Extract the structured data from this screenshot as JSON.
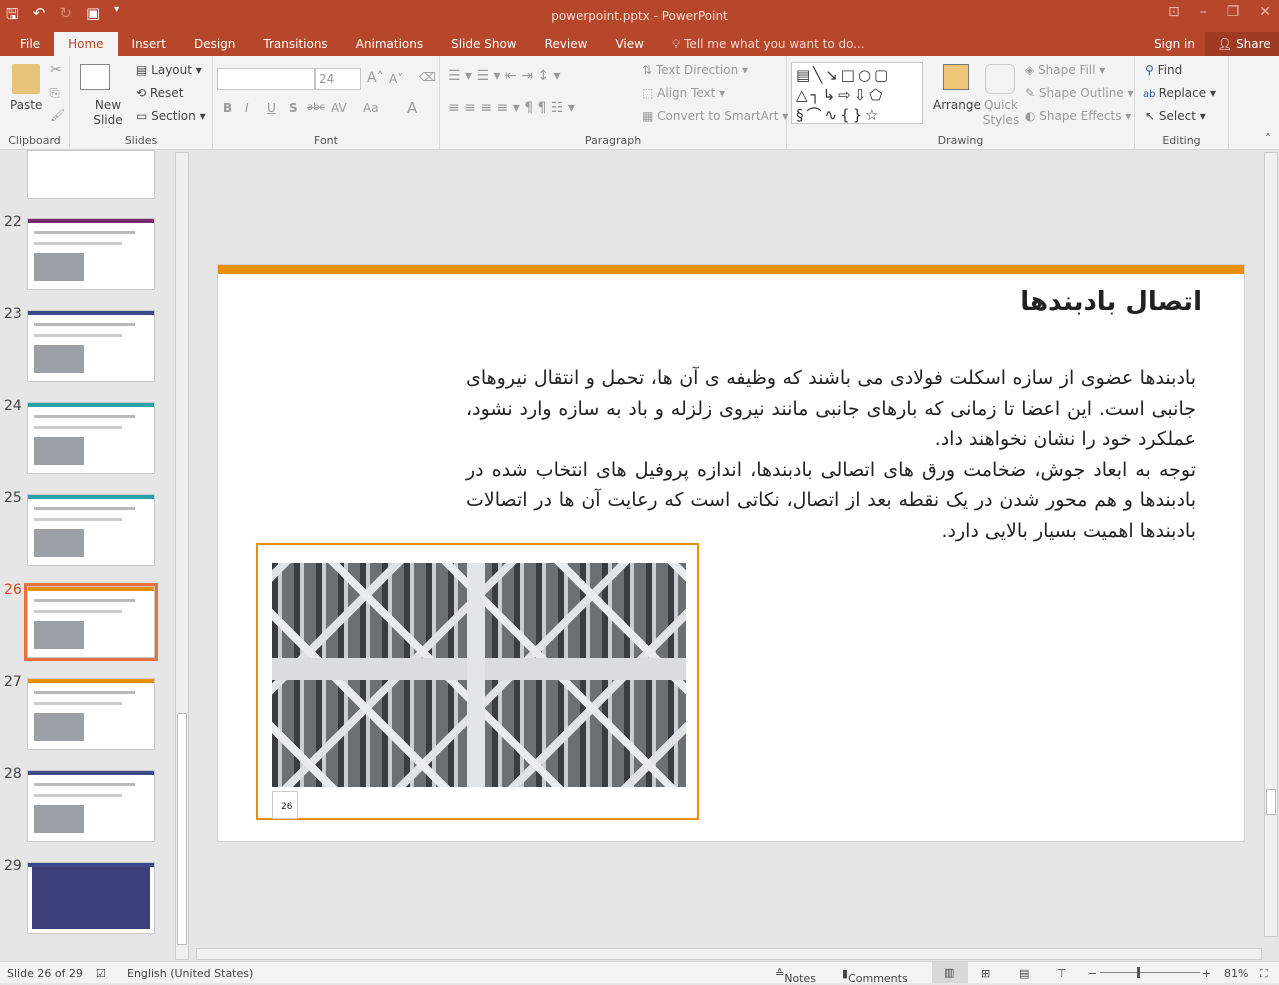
{
  "window": {
    "title": "powerpoint.pptx - PowerPoint"
  },
  "tabs": [
    "File",
    "Home",
    "Insert",
    "Design",
    "Transitions",
    "Animations",
    "Slide Show",
    "Review",
    "View"
  ],
  "tell_me": "Tell me what you want to do...",
  "sign_in": "Sign in",
  "share": "Share",
  "ribbon": {
    "clipboard": {
      "label": "Clipboard",
      "paste": "Paste"
    },
    "slides": {
      "label": "Slides",
      "new_slide": "New Slide",
      "layout": "Layout",
      "reset": "Reset",
      "section": "Section"
    },
    "font": {
      "label": "Font",
      "font_name": "",
      "font_size": "24",
      "bold": "B",
      "italic": "I",
      "underline": "U",
      "shadow": "S",
      "strike": "abc",
      "spacing": "AV",
      "case": "Aa",
      "color": "A"
    },
    "paragraph": {
      "label": "Paragraph",
      "text_direction": "Text Direction",
      "align_text": "Align Text",
      "smartart": "Convert to SmartArt"
    },
    "drawing": {
      "label": "Drawing",
      "arrange": "Arrange",
      "quick_styles": "Quick Styles",
      "shape_fill": "Shape Fill",
      "shape_outline": "Shape Outline",
      "shape_effects": "Shape Effects"
    },
    "editing": {
      "label": "Editing",
      "find": "Find",
      "replace": "Replace",
      "select": "Select"
    }
  },
  "thumbnails": [
    {
      "num": "22"
    },
    {
      "num": "23"
    },
    {
      "num": "24"
    },
    {
      "num": "25"
    },
    {
      "num": "26",
      "selected": true
    },
    {
      "num": "27"
    },
    {
      "num": "28"
    },
    {
      "num": "29"
    }
  ],
  "slide": {
    "title": "اتصال بادبندها",
    "paragraphs": [
      "بادبندها عضوی از سازه اسکلت فولادی می باشند که وظیفه ی آن ها، تحمل و انتقال نیروهای جانبی است. این اعضا تا زمانی که بارهای جانبی مانند نیروی زلزله و باد به سازه وارد نشود، عملکرد خود را نشان نخواهند داد.",
      "توجه به ابعاد جوش، ضخامت ورق های اتصالی بادبندها، اندازه پروفیل های انتخاب شده در بادبندها و هم محور شدن در یک نقطه بعد از اتصال، نکاتی است که رعایت آن ها در اتصالات بادبندها اهمیت بسیار بالایی دارد."
    ],
    "page_number": "26",
    "accent": "#e8900c"
  },
  "status": {
    "slide_info": "Slide 26 of 29",
    "language": "English (United States)",
    "notes": "Notes",
    "comments": "Comments",
    "zoom": "81%"
  },
  "colors": {
    "brand": "#b7472a",
    "selection": "#e8703f"
  }
}
